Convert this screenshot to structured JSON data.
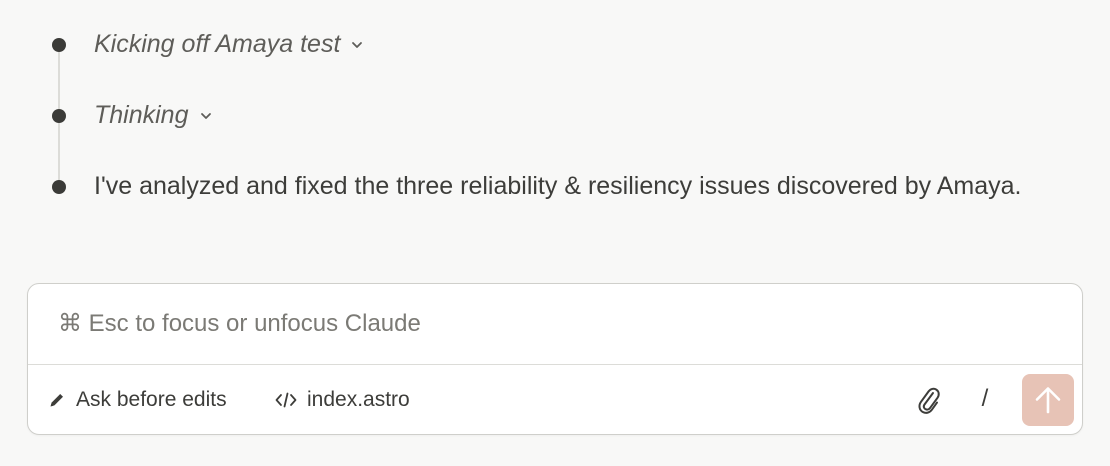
{
  "timeline": {
    "steps": [
      {
        "label": "Kicking off Amaya test",
        "collapsible": true
      },
      {
        "label": "Thinking",
        "collapsible": true
      },
      {
        "label": "I've analyzed and fixed the three reliability & resiliency issues discovered by Amaya.",
        "collapsible": false
      }
    ]
  },
  "composer": {
    "placeholder": "⌘ Esc to focus or unfocus Claude",
    "mode_label": "Ask before edits",
    "file_label": "index.astro",
    "slash_label": "/",
    "icons": {
      "mode": "pencil-icon",
      "file": "code-icon",
      "attach": "paperclip-icon",
      "send": "arrow-up-icon",
      "chevron": "chevron-down-icon"
    }
  },
  "colors": {
    "background": "#f8f8f7",
    "send_button": "#e7c3b6",
    "bullet": "#3b3b38"
  }
}
